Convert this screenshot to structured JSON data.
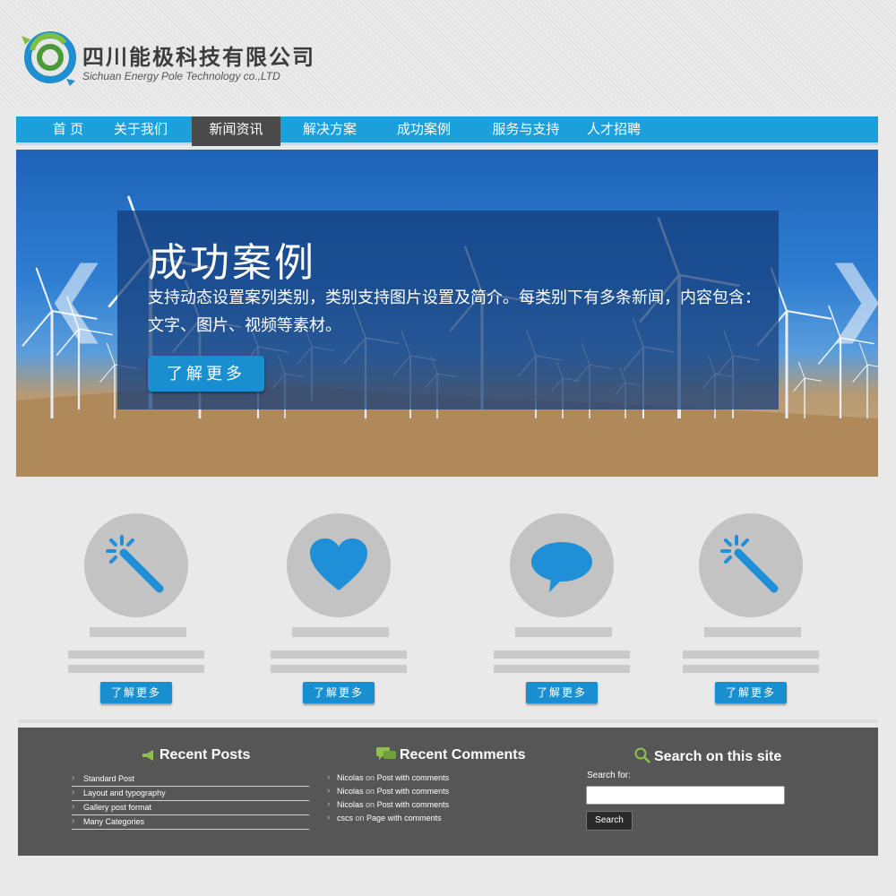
{
  "brand": {
    "name_cn": "四川能极科技有限公司",
    "name_en": "Sichuan Energy Pole Technology co.,LTD"
  },
  "nav": {
    "items": [
      {
        "label": "首  页"
      },
      {
        "label": "关于我们"
      },
      {
        "label": "新闻资讯",
        "active": true
      },
      {
        "label": "解决方案"
      },
      {
        "label": "成功案例"
      },
      {
        "label": "服务与支持"
      },
      {
        "label": "人才招聘"
      }
    ]
  },
  "hero": {
    "title": "成功案例",
    "description": "支持动态设置案列类别，类别支持图片设置及简介。每类别下有多条新闻，内容包含：文字、图片、视频等素材。",
    "button_label": "了解更多",
    "prev_arrow": "❮",
    "next_arrow": "❯"
  },
  "features": [
    {
      "icon": "magic-wand-icon",
      "button_label": "了解更多"
    },
    {
      "icon": "heart-icon",
      "button_label": "了解更多"
    },
    {
      "icon": "speech-bubble-icon",
      "button_label": "了解更多"
    },
    {
      "icon": "magic-wand-icon",
      "button_label": "了解更多"
    }
  ],
  "footer": {
    "recent_posts": {
      "title": "Recent Posts",
      "items": [
        "Standard Post",
        "Layout and typography",
        "Gallery post format",
        "Many Categories"
      ]
    },
    "recent_comments": {
      "title": "Recent Comments",
      "items": [
        {
          "author": "Nicolas",
          "on": "on",
          "post": "Post with comments"
        },
        {
          "author": "Nicolas",
          "on": "on",
          "post": "Post with comments"
        },
        {
          "author": "Nicolas",
          "on": "on",
          "post": "Post with comments"
        },
        {
          "author": "cscs",
          "on": "on",
          "post": "Page with comments"
        }
      ]
    },
    "search": {
      "title": "Search on this site",
      "label": "Search for:",
      "value": "",
      "button_label": "Search"
    }
  },
  "colors": {
    "accent": "#1ba0dc",
    "button": "#1a8fd0",
    "nav_active": "#4a4a4a",
    "footer_bg": "#565656",
    "icon_blue": "#1f8fd8"
  }
}
